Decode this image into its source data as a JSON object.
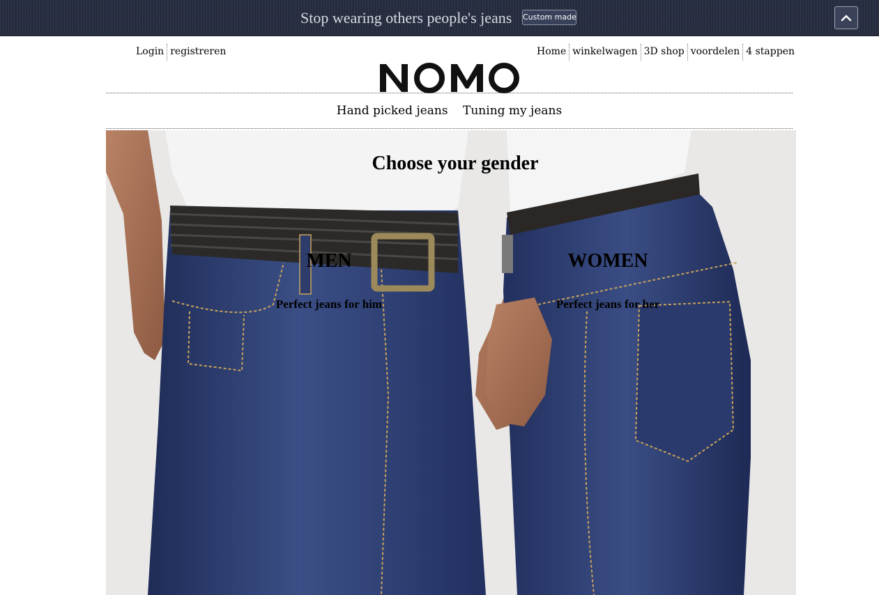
{
  "promo": {
    "text": "Stop wearing others people's jeans",
    "button_label": "Custom made"
  },
  "account_links": [
    "Login",
    "registreren"
  ],
  "main_links": [
    "Home",
    "winkelwagen",
    "3D shop",
    "voordelen",
    "4 stappen"
  ],
  "logo": "NOMO",
  "subnav": [
    "Hand picked jeans",
    "Tuning my jeans"
  ],
  "hero": {
    "title": "Choose your gender",
    "men": {
      "title": "MEN",
      "subtitle": "Perfect jeans for him"
    },
    "women": {
      "title": "WOMEN",
      "subtitle": "Perfect jeans for her"
    }
  },
  "colors": {
    "promo_bar": "#272e41",
    "denim": "#2f3f72",
    "stitching": "#c9a35a"
  }
}
